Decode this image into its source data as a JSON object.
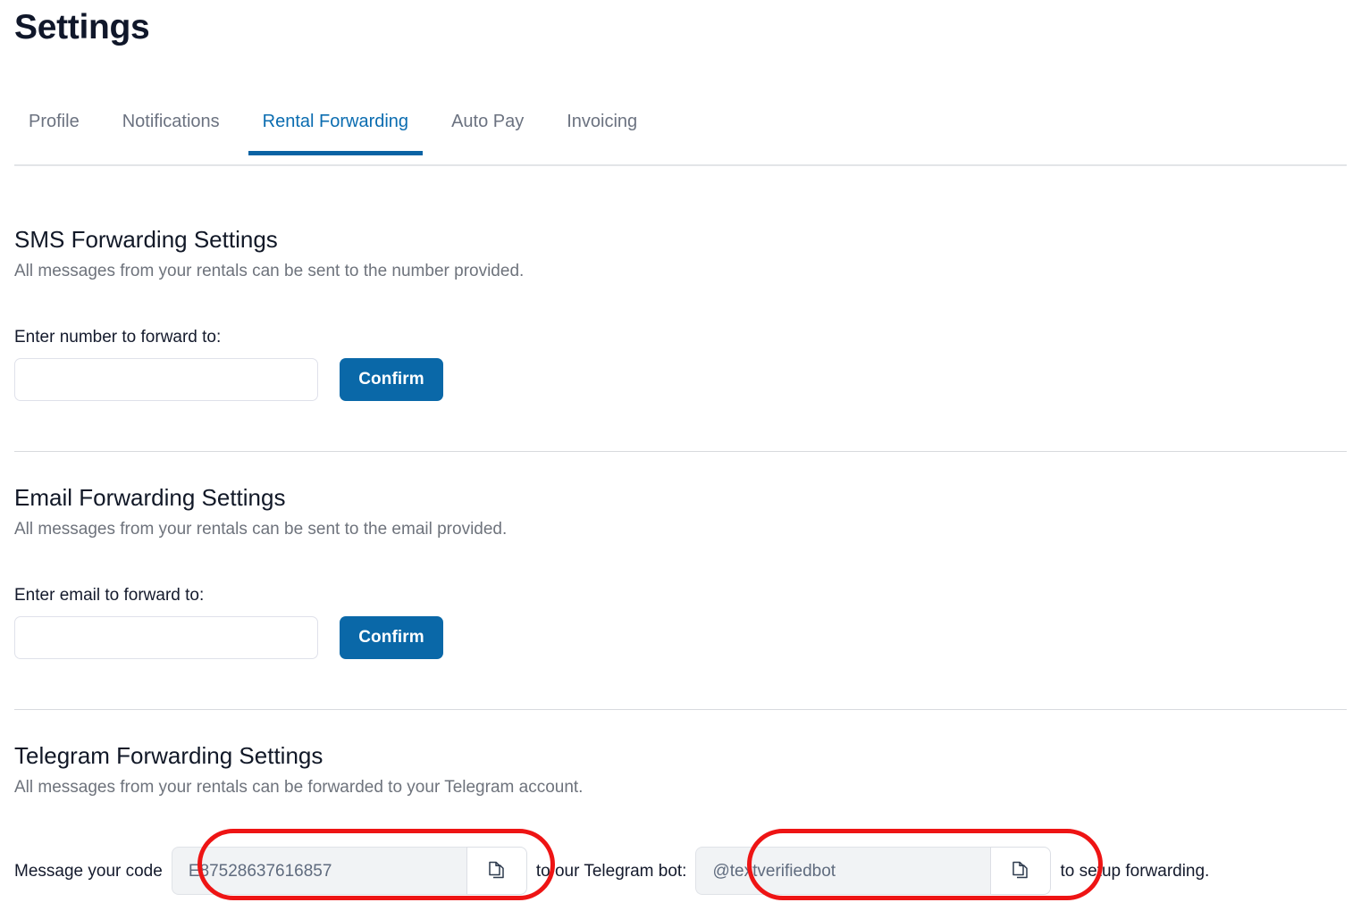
{
  "header": {
    "title": "Settings"
  },
  "tabs": [
    {
      "label": "Profile",
      "active": false
    },
    {
      "label": "Notifications",
      "active": false
    },
    {
      "label": "Rental Forwarding",
      "active": true
    },
    {
      "label": "Auto Pay",
      "active": false
    },
    {
      "label": "Invoicing",
      "active": false
    }
  ],
  "sms_section": {
    "title": "SMS Forwarding Settings",
    "description": "All messages from your rentals can be sent to the number provided.",
    "field_label": "Enter number to forward to:",
    "input_value": "",
    "input_placeholder": "",
    "confirm_label": "Confirm"
  },
  "email_section": {
    "title": "Email Forwarding Settings",
    "description": "All messages from your rentals can be sent to the email provided.",
    "field_label": "Enter email to forward to:",
    "input_value": "",
    "input_placeholder": "",
    "confirm_label": "Confirm"
  },
  "telegram_section": {
    "title": "Telegram Forwarding Settings",
    "description": "All messages from your rentals can be forwarded to your Telegram account.",
    "text_before_code": "Message your code",
    "code_value": "E87528637616857",
    "text_between": "to our Telegram bot:",
    "bot_value": "@textverifiedbot",
    "text_after": "to setup forwarding.",
    "copy_icon_name": "copy-icon"
  },
  "colors": {
    "accent_blue": "#0a68a8",
    "tab_active": "#0a6cb0",
    "annotation_red": "#ee1414",
    "muted_text": "#6e737c"
  }
}
